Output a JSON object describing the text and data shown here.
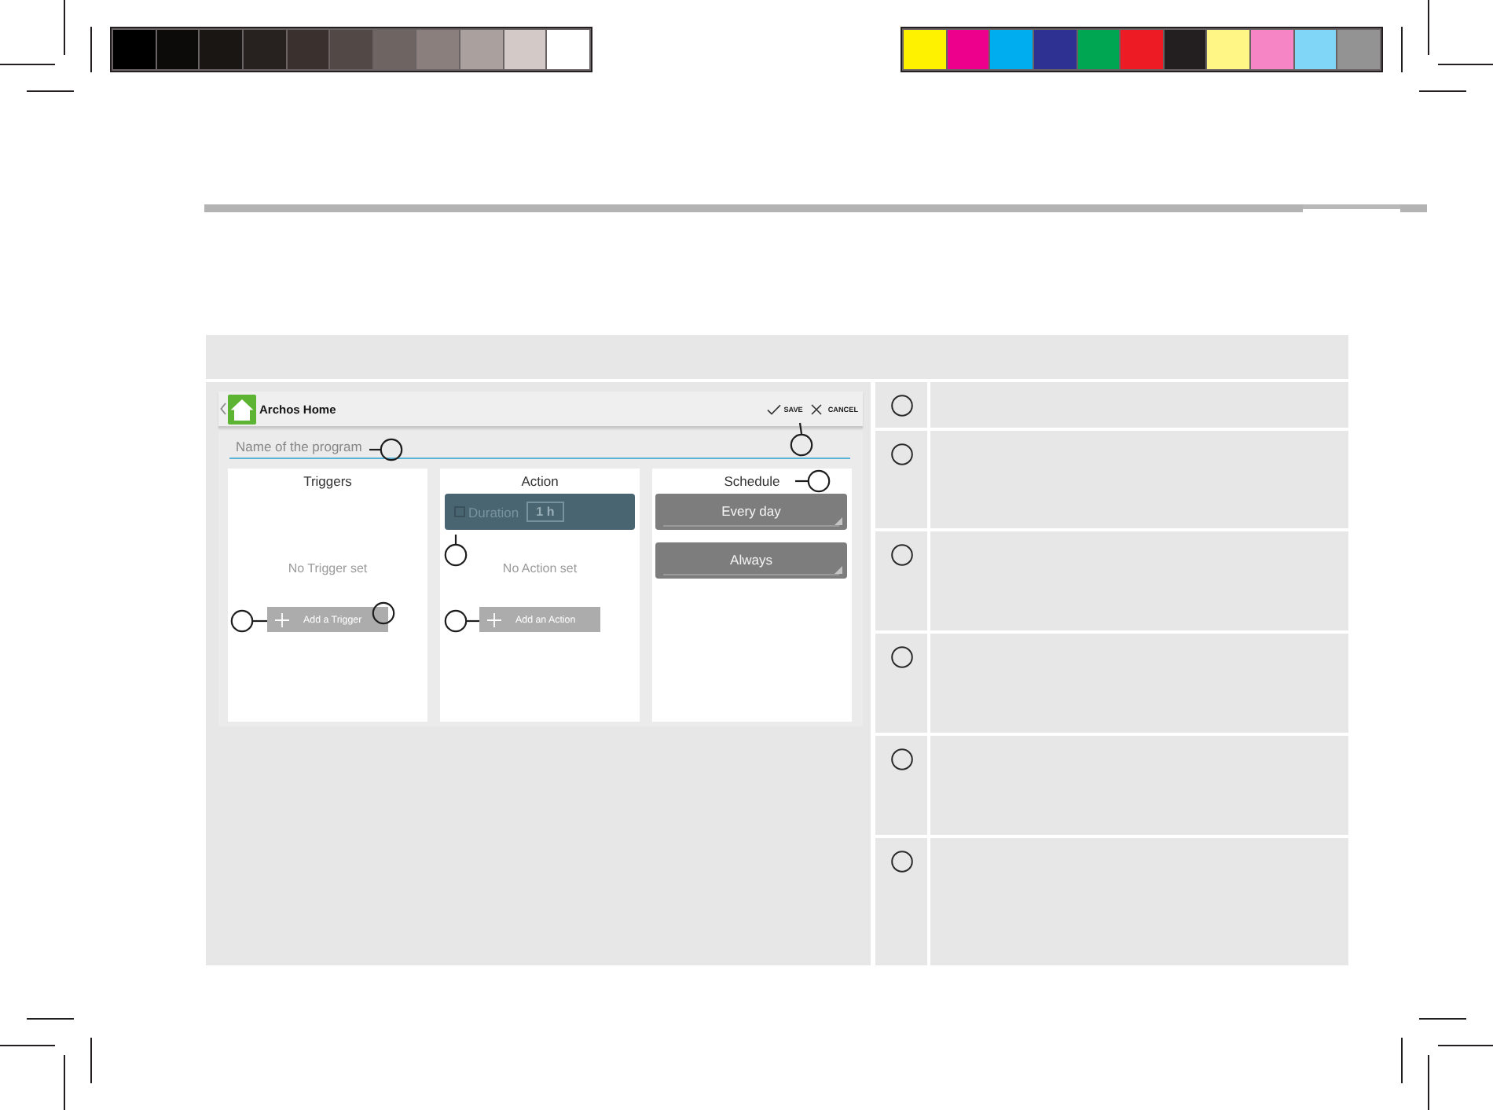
{
  "color_bars": {
    "grayscale": [
      {
        "color": "#000000"
      },
      {
        "color": "#0d0b0a"
      },
      {
        "color": "#1a1614"
      },
      {
        "color": "#27221f"
      },
      {
        "color": "#3a302d"
      },
      {
        "color": "#524845"
      },
      {
        "color": "#6e6461"
      },
      {
        "color": "#8a7f7c"
      },
      {
        "color": "#aaa09d"
      },
      {
        "color": "#d3cac8"
      },
      {
        "color": "#ffffff"
      }
    ],
    "process": [
      {
        "color": "#fff200"
      },
      {
        "color": "#ec008c"
      },
      {
        "color": "#00aeef"
      },
      {
        "color": "#2e3192"
      },
      {
        "color": "#00a651"
      },
      {
        "color": "#ed1c24"
      },
      {
        "color": "#231f20"
      },
      {
        "color": "#fff685"
      },
      {
        "color": "#f685c6"
      },
      {
        "color": "#7fd6f7"
      },
      {
        "color": "#939393"
      }
    ]
  },
  "app_screenshot": {
    "app_bar": {
      "title": "Archos Home",
      "actions": [
        {
          "kind": "save",
          "label": "SAVE"
        },
        {
          "kind": "cancel",
          "label": "CANCEL"
        }
      ]
    },
    "name_field": {
      "placeholder": "Name of the program"
    },
    "panels": [
      {
        "kind": "list",
        "title": "Triggers",
        "empty_text": "No Trigger set",
        "add_button": "Add a Trigger"
      },
      {
        "kind": "list",
        "title": "Action",
        "duration": {
          "label": "Duration",
          "checked": false,
          "value": "1 h"
        },
        "empty_text": "No Action set",
        "add_button": "Add an Action"
      },
      {
        "kind": "schedule",
        "title": "Schedule",
        "dropdowns": [
          "Every day",
          "Always"
        ]
      }
    ]
  }
}
